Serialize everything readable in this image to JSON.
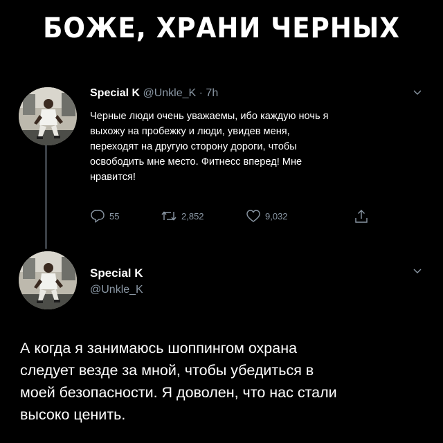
{
  "headline": "БОЖЕ, ХРАНИ ЧЕРНЫХ",
  "tweet1": {
    "display_name": "Special K",
    "meta": " @Unkle_K · 7h",
    "text": "Черные люди очень уважаемы, ибо каждую ночь я\nвыхожу на пробежку и люди, увидев меня,\nпереходят на другую сторону дороги, чтобы\nосвободить мне место. Фитнесс вперед! Мне\nнравится!",
    "replies": "55",
    "retweets": "2,852",
    "likes": "9,032"
  },
  "tweet2": {
    "display_name": "Special K",
    "handle": "@Unkle_K",
    "text": "А когда я занимаюсь шоппингом охрана\nследует везде за мной, чтобы убедиться в\nмоей безопасности. Я доволен, что нас стали\nвысоко ценить."
  },
  "icons": {
    "caret": "chevron-down-icon",
    "reply": "reply-icon",
    "retweet": "retweet-icon",
    "like": "heart-icon",
    "share": "share-icon"
  },
  "colors": {
    "background": "#000000",
    "text": "#ffffff",
    "muted": "#8b98a5",
    "thread_line": "#3a3f45"
  }
}
